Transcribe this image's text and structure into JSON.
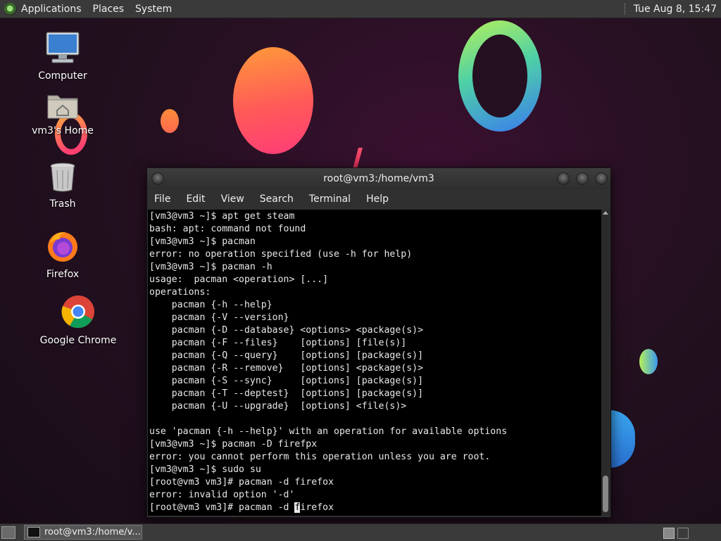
{
  "top_panel": {
    "menus": [
      "Applications",
      "Places",
      "System"
    ],
    "clock": "Tue Aug  8, 15:47"
  },
  "desktop": {
    "icons": [
      {
        "label": "Computer",
        "icon": "computer-icon"
      },
      {
        "label": "vm3's Home",
        "icon": "home-folder-icon"
      },
      {
        "label": "Trash",
        "icon": "trash-icon"
      },
      {
        "label": "Firefox",
        "icon": "firefox-icon"
      },
      {
        "label": "Google Chrome",
        "icon": "chrome-icon"
      }
    ]
  },
  "terminal": {
    "title": "root@vm3:/home/vm3",
    "menu": [
      "File",
      "Edit",
      "View",
      "Search",
      "Terminal",
      "Help"
    ],
    "lines": [
      "[vm3@vm3 ~]$ apt get steam",
      "bash: apt: command not found",
      "[vm3@vm3 ~]$ pacman",
      "error: no operation specified (use -h for help)",
      "[vm3@vm3 ~]$ pacman -h",
      "usage:  pacman <operation> [...]",
      "operations:",
      "    pacman {-h --help}",
      "    pacman {-V --version}",
      "    pacman {-D --database} <options> <package(s)>",
      "    pacman {-F --files}    [options] [file(s)]",
      "    pacman {-Q --query}    [options] [package(s)]",
      "    pacman {-R --remove}   [options] <package(s)>",
      "    pacman {-S --sync}     [options] [package(s)]",
      "    pacman {-T --deptest}  [options] [package(s)]",
      "    pacman {-U --upgrade}  [options] <file(s)>",
      "",
      "use 'pacman {-h --help}' with an operation for available options",
      "[vm3@vm3 ~]$ pacman -D firefpx",
      "error: you cannot perform this operation unless you are root.",
      "[vm3@vm3 ~]$ sudo su",
      "[root@vm3 vm3]# pacman -d firefox",
      "error: invalid option '-d'"
    ],
    "current_line_before_cursor": "[root@vm3 vm3]# pacman -d ",
    "cursor_char": "f",
    "current_line_after_cursor": "irefox"
  },
  "bottom_panel": {
    "task_label": "root@vm3:/home/v..."
  }
}
